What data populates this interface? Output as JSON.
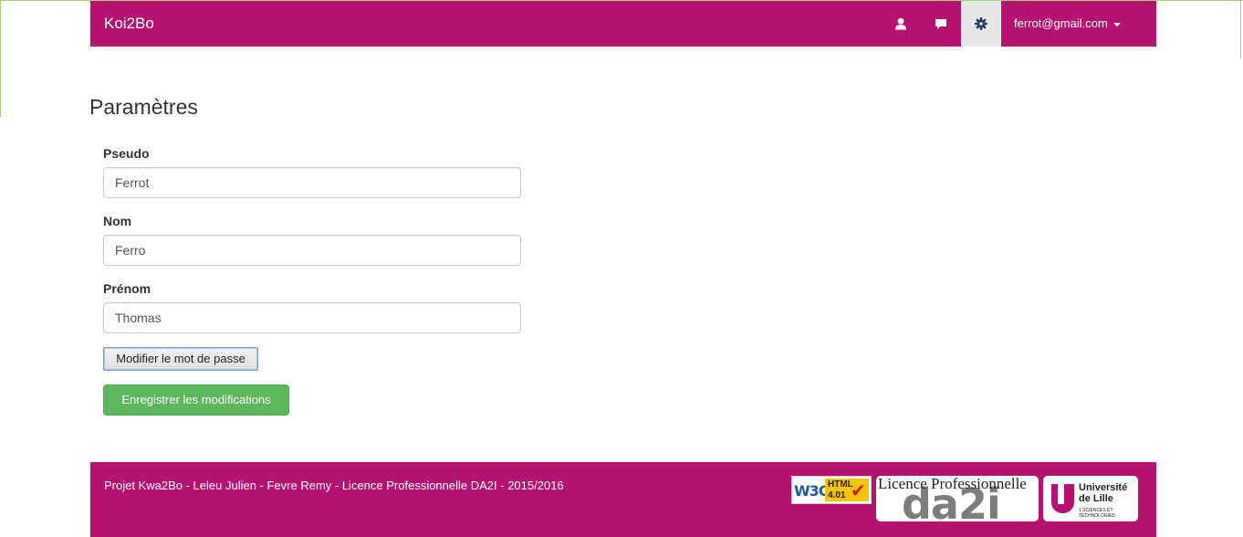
{
  "navbar": {
    "brand": "Koi2Bo",
    "account_email": "ferrot@gmail.com",
    "icons": [
      "user-icon",
      "comment-icon",
      "gear-icon"
    ]
  },
  "page": {
    "title": "Paramètres"
  },
  "form": {
    "pseudo_label": "Pseudo",
    "pseudo_value": "Ferrot",
    "nom_label": "Nom",
    "nom_value": "Ferro",
    "prenom_label": "Prénom",
    "prenom_value": "Thomas",
    "change_password_label": "Modifier le mot de passe",
    "save_label": "Enregistrer les modifications"
  },
  "footer": {
    "text": "Projet Kwa2Bo - Leleu Julien - Fevre Remy - Licence Professionnelle DA2I - 2015/2016",
    "badges": {
      "w3c_logo": "W3C",
      "w3c_html": "HTML",
      "w3c_version": "4.01",
      "da2i_top": "Licence Professionnelle",
      "da2i_big": "da2i",
      "lille_name_1": "Université",
      "lille_name_2": "de Lille",
      "lille_sub": "1 SCIENCES ET TECHNOLOGIES"
    }
  },
  "colors": {
    "brand": "#b5136f",
    "active_tab": "#e7e7e7",
    "success": "#5cb85c"
  }
}
